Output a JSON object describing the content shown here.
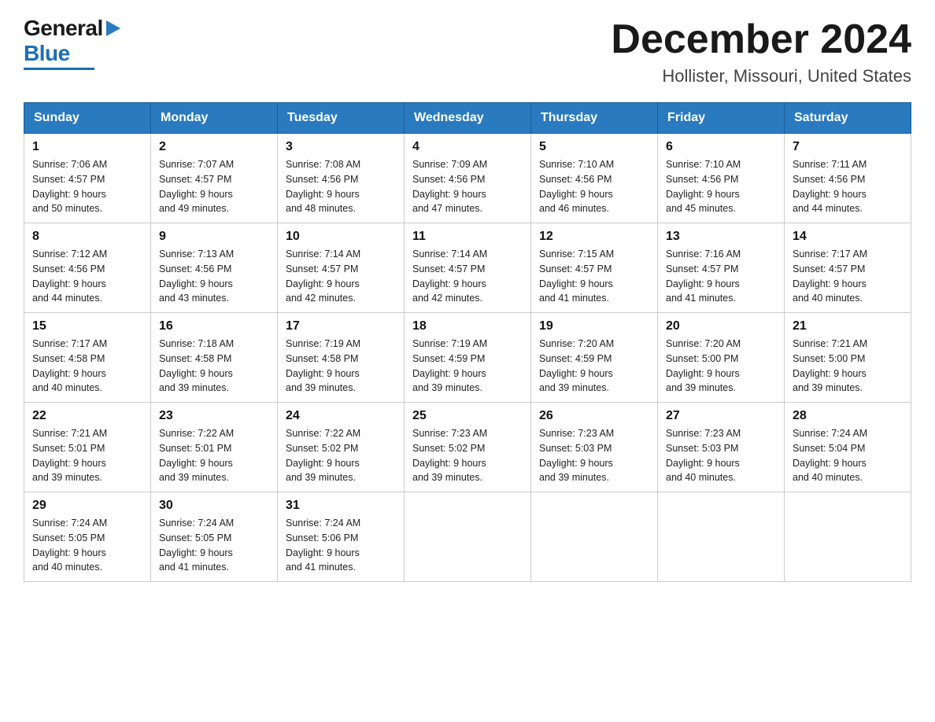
{
  "logo": {
    "general": "General",
    "blue": "Blue"
  },
  "title": "December 2024",
  "location": "Hollister, Missouri, United States",
  "weekdays": [
    "Sunday",
    "Monday",
    "Tuesday",
    "Wednesday",
    "Thursday",
    "Friday",
    "Saturday"
  ],
  "weeks": [
    [
      {
        "day": 1,
        "sunrise": "7:06 AM",
        "sunset": "4:57 PM",
        "daylight": "9 hours and 50 minutes."
      },
      {
        "day": 2,
        "sunrise": "7:07 AM",
        "sunset": "4:57 PM",
        "daylight": "9 hours and 49 minutes."
      },
      {
        "day": 3,
        "sunrise": "7:08 AM",
        "sunset": "4:56 PM",
        "daylight": "9 hours and 48 minutes."
      },
      {
        "day": 4,
        "sunrise": "7:09 AM",
        "sunset": "4:56 PM",
        "daylight": "9 hours and 47 minutes."
      },
      {
        "day": 5,
        "sunrise": "7:10 AM",
        "sunset": "4:56 PM",
        "daylight": "9 hours and 46 minutes."
      },
      {
        "day": 6,
        "sunrise": "7:10 AM",
        "sunset": "4:56 PM",
        "daylight": "9 hours and 45 minutes."
      },
      {
        "day": 7,
        "sunrise": "7:11 AM",
        "sunset": "4:56 PM",
        "daylight": "9 hours and 44 minutes."
      }
    ],
    [
      {
        "day": 8,
        "sunrise": "7:12 AM",
        "sunset": "4:56 PM",
        "daylight": "9 hours and 44 minutes."
      },
      {
        "day": 9,
        "sunrise": "7:13 AM",
        "sunset": "4:56 PM",
        "daylight": "9 hours and 43 minutes."
      },
      {
        "day": 10,
        "sunrise": "7:14 AM",
        "sunset": "4:57 PM",
        "daylight": "9 hours and 42 minutes."
      },
      {
        "day": 11,
        "sunrise": "7:14 AM",
        "sunset": "4:57 PM",
        "daylight": "9 hours and 42 minutes."
      },
      {
        "day": 12,
        "sunrise": "7:15 AM",
        "sunset": "4:57 PM",
        "daylight": "9 hours and 41 minutes."
      },
      {
        "day": 13,
        "sunrise": "7:16 AM",
        "sunset": "4:57 PM",
        "daylight": "9 hours and 41 minutes."
      },
      {
        "day": 14,
        "sunrise": "7:17 AM",
        "sunset": "4:57 PM",
        "daylight": "9 hours and 40 minutes."
      }
    ],
    [
      {
        "day": 15,
        "sunrise": "7:17 AM",
        "sunset": "4:58 PM",
        "daylight": "9 hours and 40 minutes."
      },
      {
        "day": 16,
        "sunrise": "7:18 AM",
        "sunset": "4:58 PM",
        "daylight": "9 hours and 39 minutes."
      },
      {
        "day": 17,
        "sunrise": "7:19 AM",
        "sunset": "4:58 PM",
        "daylight": "9 hours and 39 minutes."
      },
      {
        "day": 18,
        "sunrise": "7:19 AM",
        "sunset": "4:59 PM",
        "daylight": "9 hours and 39 minutes."
      },
      {
        "day": 19,
        "sunrise": "7:20 AM",
        "sunset": "4:59 PM",
        "daylight": "9 hours and 39 minutes."
      },
      {
        "day": 20,
        "sunrise": "7:20 AM",
        "sunset": "5:00 PM",
        "daylight": "9 hours and 39 minutes."
      },
      {
        "day": 21,
        "sunrise": "7:21 AM",
        "sunset": "5:00 PM",
        "daylight": "9 hours and 39 minutes."
      }
    ],
    [
      {
        "day": 22,
        "sunrise": "7:21 AM",
        "sunset": "5:01 PM",
        "daylight": "9 hours and 39 minutes."
      },
      {
        "day": 23,
        "sunrise": "7:22 AM",
        "sunset": "5:01 PM",
        "daylight": "9 hours and 39 minutes."
      },
      {
        "day": 24,
        "sunrise": "7:22 AM",
        "sunset": "5:02 PM",
        "daylight": "9 hours and 39 minutes."
      },
      {
        "day": 25,
        "sunrise": "7:23 AM",
        "sunset": "5:02 PM",
        "daylight": "9 hours and 39 minutes."
      },
      {
        "day": 26,
        "sunrise": "7:23 AM",
        "sunset": "5:03 PM",
        "daylight": "9 hours and 39 minutes."
      },
      {
        "day": 27,
        "sunrise": "7:23 AM",
        "sunset": "5:03 PM",
        "daylight": "9 hours and 40 minutes."
      },
      {
        "day": 28,
        "sunrise": "7:24 AM",
        "sunset": "5:04 PM",
        "daylight": "9 hours and 40 minutes."
      }
    ],
    [
      {
        "day": 29,
        "sunrise": "7:24 AM",
        "sunset": "5:05 PM",
        "daylight": "9 hours and 40 minutes."
      },
      {
        "day": 30,
        "sunrise": "7:24 AM",
        "sunset": "5:05 PM",
        "daylight": "9 hours and 41 minutes."
      },
      {
        "day": 31,
        "sunrise": "7:24 AM",
        "sunset": "5:06 PM",
        "daylight": "9 hours and 41 minutes."
      },
      null,
      null,
      null,
      null
    ]
  ]
}
